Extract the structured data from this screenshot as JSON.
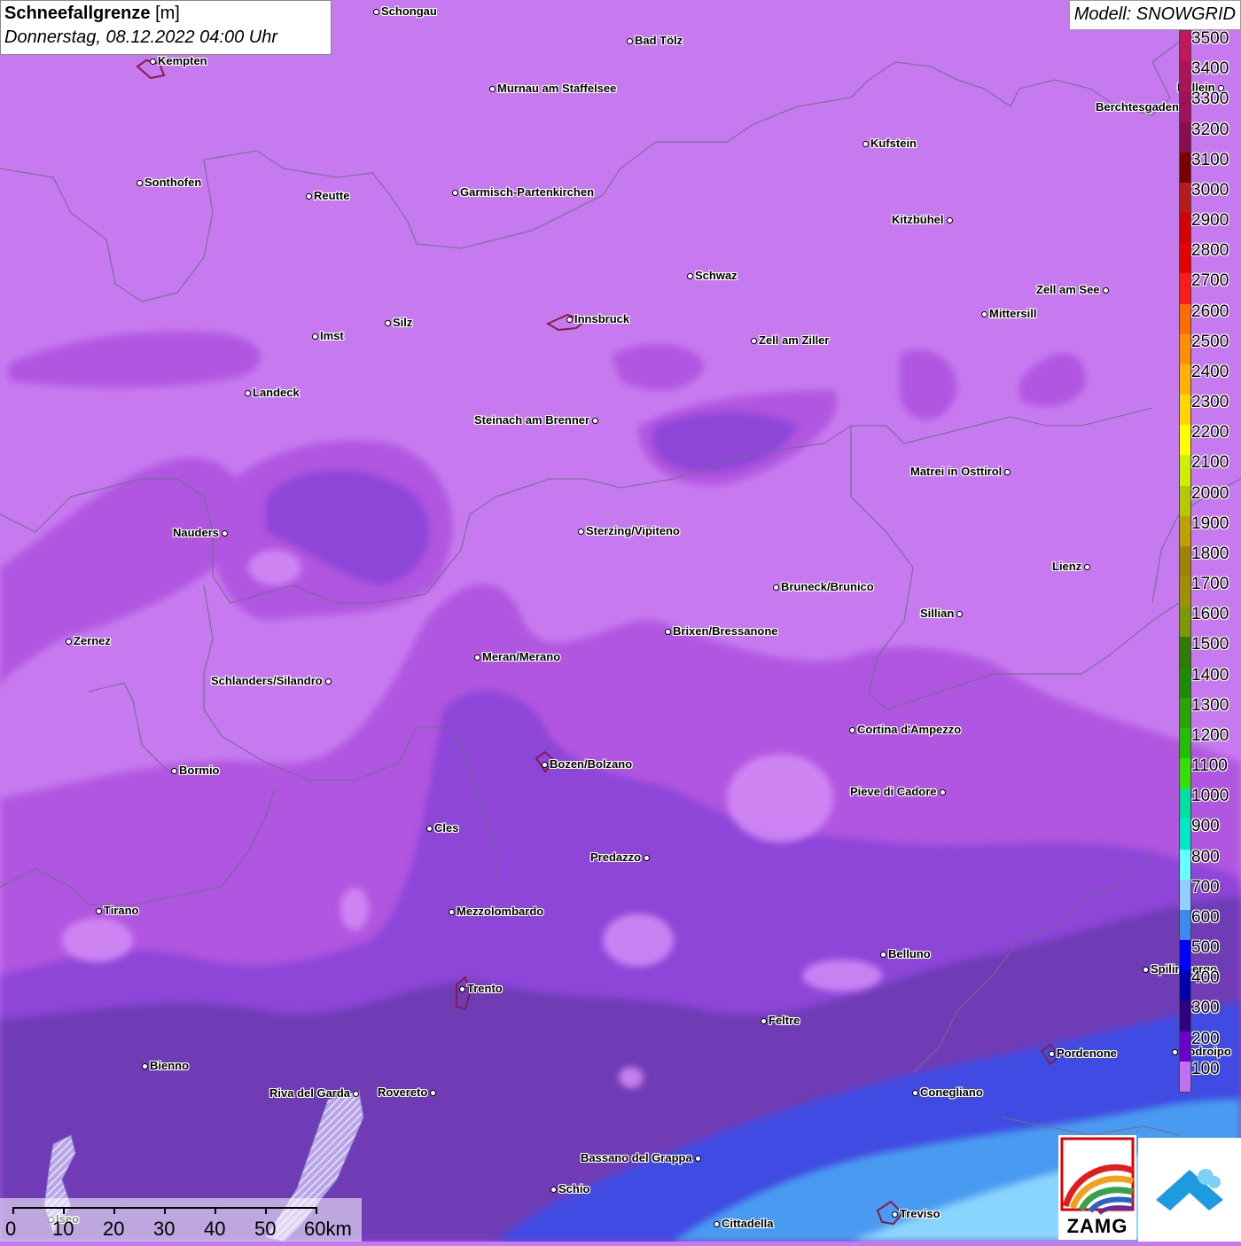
{
  "title": {
    "main": "Schneefallgrenze",
    "unit": " [m]",
    "datetime": "Donnerstag, 08.12.2022 04:00 Uhr"
  },
  "model": "Modell: SNOWGRID",
  "legend": {
    "labels": [
      "3500",
      "3400",
      "3300",
      "3200",
      "3100",
      "3000",
      "2900",
      "2800",
      "2700",
      "2600",
      "2500",
      "2400",
      "2300",
      "2200",
      "2100",
      "2000",
      "1900",
      "1800",
      "1700",
      "1600",
      "1500",
      "1400",
      "1300",
      "1200",
      "1100",
      "1000",
      "900",
      "800",
      "700",
      "600",
      "500",
      "400",
      "300",
      "200",
      "100"
    ],
    "colors": [
      "#c2185b",
      "#ad1457",
      "#a0115a",
      "#880e4f",
      "#7b0000",
      "#b71c1c",
      "#d50000",
      "#e60000",
      "#ff1a1a",
      "#ff6d00",
      "#ff9100",
      "#ffb300",
      "#ffd600",
      "#ffff00",
      "#ccf000",
      "#b5c800",
      "#c0a000",
      "#a08300",
      "#a09000",
      "#7a9a00",
      "#2e7d00",
      "#1e8c00",
      "#26a600",
      "#20c000",
      "#33e000",
      "#00e0a0",
      "#00e8c8",
      "#66ffff",
      "#90d0ff",
      "#3b8af0",
      "#0000ff",
      "#0000b0",
      "#300080",
      "#6a00c8",
      "#c070f0"
    ]
  },
  "cities": [
    {
      "name": "Schongau"
    },
    {
      "name": "Bad Tölz"
    },
    {
      "name": "Kempten"
    },
    {
      "name": "Murnau am Staffelsee"
    },
    {
      "name": "Hallein"
    },
    {
      "name": "Berchtesgaden"
    },
    {
      "name": "Kufstein"
    },
    {
      "name": "Sonthofen"
    },
    {
      "name": "Reutte"
    },
    {
      "name": "Garmisch-Partenkirchen"
    },
    {
      "name": "Kitzbühel"
    },
    {
      "name": "Schwaz"
    },
    {
      "name": "Zell am See"
    },
    {
      "name": "Innsbruck"
    },
    {
      "name": "Mittersill"
    },
    {
      "name": "Imst"
    },
    {
      "name": "Silz"
    },
    {
      "name": "Zell am Ziller"
    },
    {
      "name": "Landeck"
    },
    {
      "name": "Steinach am Brenner"
    },
    {
      "name": "Matrei in Osttirol"
    },
    {
      "name": "Nauders"
    },
    {
      "name": "Sterzing/Vipiteno"
    },
    {
      "name": "Lienz"
    },
    {
      "name": "Bruneck/Brunico"
    },
    {
      "name": "Sillian"
    },
    {
      "name": "Zernez"
    },
    {
      "name": "Brixen/Bressanone"
    },
    {
      "name": "Meran/Merano"
    },
    {
      "name": "Schlanders/Silandro"
    },
    {
      "name": "Cortina d'Ampezzo"
    },
    {
      "name": "Bozen/Bolzano"
    },
    {
      "name": "Bormio"
    },
    {
      "name": "Pieve di Cadore"
    },
    {
      "name": "Cles"
    },
    {
      "name": "Predazzo"
    },
    {
      "name": "Tirano"
    },
    {
      "name": "Mezzolombardo"
    },
    {
      "name": "Belluno"
    },
    {
      "name": "Spilimbergo"
    },
    {
      "name": "Trento"
    },
    {
      "name": "Feltre"
    },
    {
      "name": "Pordenone"
    },
    {
      "name": "Codroipo"
    },
    {
      "name": "Bienno"
    },
    {
      "name": "Riva del Garda"
    },
    {
      "name": "Rovereto"
    },
    {
      "name": "Conegliano"
    },
    {
      "name": "Bassano del Grappa"
    },
    {
      "name": "Schio"
    },
    {
      "name": "Iseo"
    },
    {
      "name": "Treviso"
    },
    {
      "name": "Cittadella"
    }
  ],
  "scalebar": {
    "labels": [
      "0",
      "10",
      "20",
      "30",
      "40",
      "50",
      "60km"
    ]
  },
  "logos": {
    "zamg": "ZAMG"
  }
}
